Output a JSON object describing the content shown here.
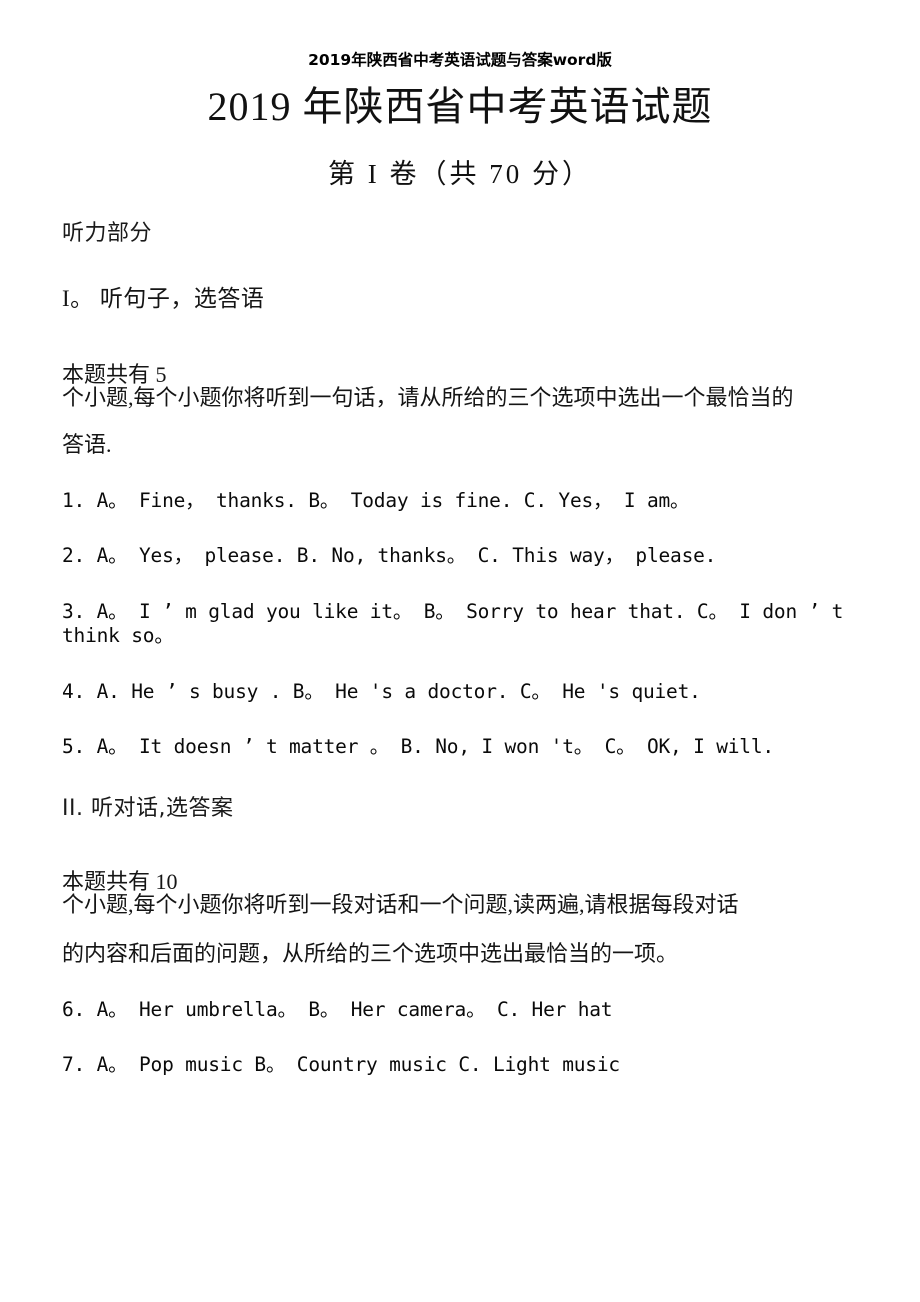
{
  "document": {
    "running_head": "2019年陕西省中考英语试题与答案word版",
    "title": "2019 年陕西省中考英语试题",
    "paper_part": "第 I 卷（共 70 分）"
  },
  "listening": {
    "part_label": "听力部分",
    "section_one": {
      "heading": "I。 听句子，选答语",
      "instruction_lead": "本题共有 5",
      "instruction_body": "个小题,每个小题你将听到一句话，请从所给的三个选项中选出一个最恰当的",
      "instruction_tail": "答语.",
      "questions": [
        {
          "number": "1.",
          "text": "1. A。 Fine， thanks. B。 Today is fine. C. Yes， I am。"
        },
        {
          "number": "2.",
          "text": "2. A。 Yes， please. B. No, thanks。 C. This way， please."
        },
        {
          "number": "3.",
          "text": "3. A。 I ’ m glad you like it。 B。 Sorry to hear that. C。 I don ’ t think so。"
        },
        {
          "number": "4.",
          "text": "4. A. He ’ s busy . B。 He 's a doctor. C。 He 's quiet."
        },
        {
          "number": "5.",
          "text": "5. A。 It doesn ’ t matter 。 B. No, I won 't。 C。 OK, I will."
        }
      ]
    },
    "section_two": {
      "heading": "II. 听对话,选答案",
      "instruction_lead": "本题共有 10",
      "instruction_body": "个小题,每个小题你将听到一段对话和一个问题,读两遍,请根据每段对话",
      "instruction_tail": "的内容和后面的问题，从所给的三个选项中选出最恰当的一项。",
      "questions": [
        {
          "number": "6.",
          "text": "6. A。 Her umbrella。 B。 Her camera。 C. Her hat"
        },
        {
          "number": "7.",
          "text": "7. A。 Pop music B。 Country music C. Light music"
        }
      ]
    }
  }
}
